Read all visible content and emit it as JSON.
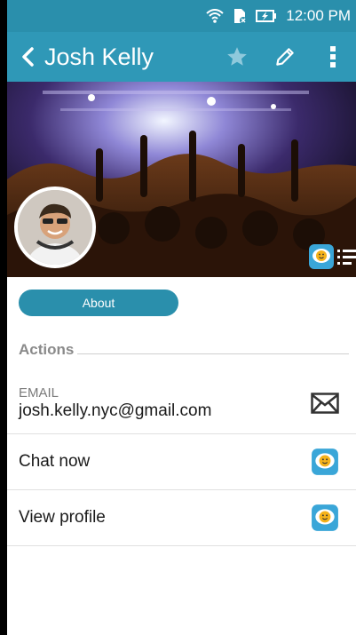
{
  "status_bar": {
    "time": "12:00 PM"
  },
  "app_bar": {
    "title": "Josh Kelly"
  },
  "about_button": {
    "label": "About"
  },
  "actions_section": {
    "title": "Actions"
  },
  "email": {
    "label": "EMAIL",
    "value": "josh.kelly.nyc@gmail.com"
  },
  "items": [
    {
      "label": "Chat now"
    },
    {
      "label": "View profile"
    }
  ],
  "colors": {
    "status_bar": "#2a8fac",
    "app_bar": "#2f98b7",
    "accent": "#2a8fac",
    "chat_icon": "#3aa6d8"
  },
  "icons": [
    "wifi-icon",
    "sim-card-icon",
    "battery-charging-icon",
    "back-arrow-icon",
    "star-icon",
    "edit-pencil-icon",
    "more-vert-icon",
    "chat-bubble-icon",
    "list-view-icon",
    "mail-icon"
  ]
}
